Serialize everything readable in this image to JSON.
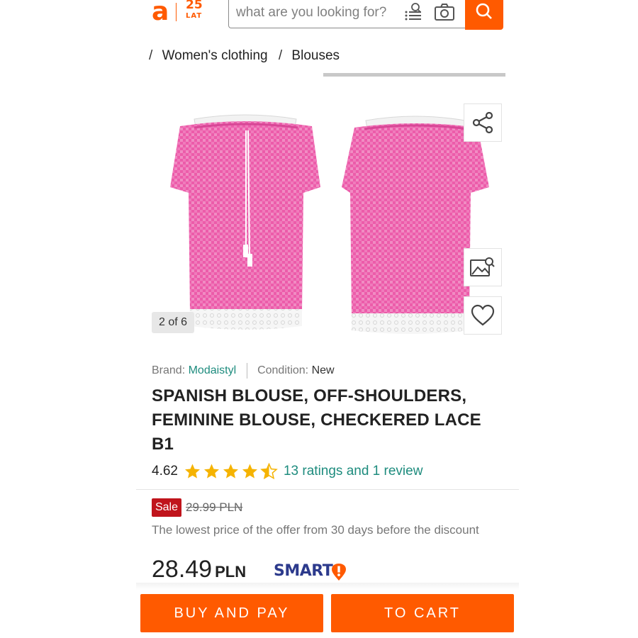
{
  "header": {
    "logo_letter": "a",
    "logo_anniv_number": "25",
    "logo_anniv_word": "LAT",
    "search_placeholder": "what are you looking for?",
    "accent_color": "#ff5a00"
  },
  "breadcrumb": {
    "items": [
      "Women's clothing",
      "Blouses"
    ]
  },
  "gallery": {
    "counter": "2 of 6",
    "product_color": "#ee5aa8",
    "icons": [
      "share-icon",
      "image-search-icon",
      "heart-icon"
    ]
  },
  "product": {
    "brand_label": "Brand:",
    "brand": "Modaistyl",
    "condition_label": "Condition:",
    "condition": "New",
    "title": "SPANISH BLOUSE, OFF-SHOULDERS, FEMININE BLOUSE, CHECKERED LACE B1",
    "rating": "4.62",
    "stars_filled": 4.62,
    "stars_total": 5,
    "ratings_link": "13 ratings and 1 review"
  },
  "pricing": {
    "sale_badge": "Sale",
    "old_price": "29.99 PLN",
    "lowest_note": "The lowest price of the offer from 30 days before the discount",
    "price": "28.49",
    "currency": "PLN",
    "smart_label": "SMART"
  },
  "actions": {
    "buy_label": "BUY AND PAY",
    "cart_label": "TO CART"
  }
}
